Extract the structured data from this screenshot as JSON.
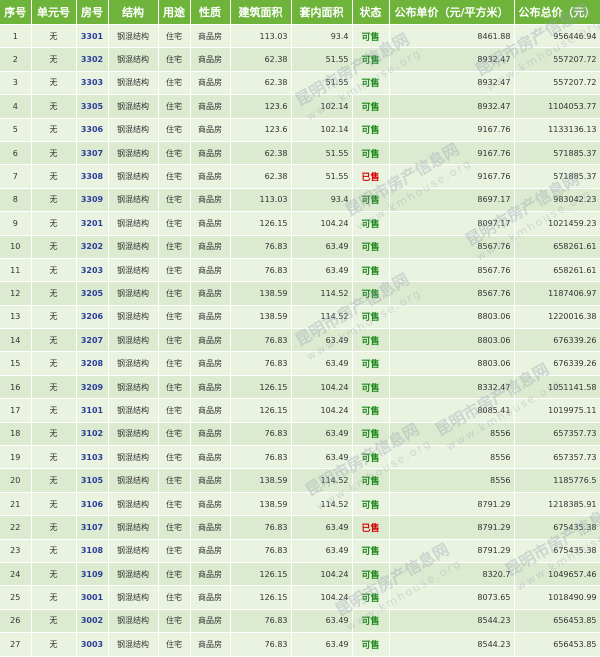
{
  "headers": [
    "序号",
    "单元号",
    "房号",
    "结构",
    "用途",
    "性质",
    "建筑面积",
    "套内面积",
    "状态",
    "公布单价（元/平方米）",
    "公布总价（元）"
  ],
  "rows": [
    [
      "1",
      "无",
      "3301",
      "钢混结构",
      "住宅",
      "商品房",
      "113.03",
      "93.4",
      "可售",
      "8461.88",
      "956446.94"
    ],
    [
      "2",
      "无",
      "3302",
      "钢混结构",
      "住宅",
      "商品房",
      "62.38",
      "51.55",
      "可售",
      "8932.47",
      "557207.72"
    ],
    [
      "3",
      "无",
      "3303",
      "钢混结构",
      "住宅",
      "商品房",
      "62.38",
      "51.55",
      "可售",
      "8932.47",
      "557207.72"
    ],
    [
      "4",
      "无",
      "3305",
      "钢混结构",
      "住宅",
      "商品房",
      "123.6",
      "102.14",
      "可售",
      "8932.47",
      "1104053.77"
    ],
    [
      "5",
      "无",
      "3306",
      "钢混结构",
      "住宅",
      "商品房",
      "123.6",
      "102.14",
      "可售",
      "9167.76",
      "1133136.13"
    ],
    [
      "6",
      "无",
      "3307",
      "钢混结构",
      "住宅",
      "商品房",
      "62.38",
      "51.55",
      "可售",
      "9167.76",
      "571885.37"
    ],
    [
      "7",
      "无",
      "3308",
      "钢混结构",
      "住宅",
      "商品房",
      "62.38",
      "51.55",
      "已售",
      "9167.76",
      "571885.37"
    ],
    [
      "8",
      "无",
      "3309",
      "钢混结构",
      "住宅",
      "商品房",
      "113.03",
      "93.4",
      "可售",
      "8697.17",
      "983042.23"
    ],
    [
      "9",
      "无",
      "3201",
      "钢混结构",
      "住宅",
      "商品房",
      "126.15",
      "104.24",
      "可售",
      "8097.17",
      "1021459.23"
    ],
    [
      "10",
      "无",
      "3202",
      "钢混结构",
      "住宅",
      "商品房",
      "76.83",
      "63.49",
      "可售",
      "8567.76",
      "658261.61"
    ],
    [
      "11",
      "无",
      "3203",
      "钢混结构",
      "住宅",
      "商品房",
      "76.83",
      "63.49",
      "可售",
      "8567.76",
      "658261.61"
    ],
    [
      "12",
      "无",
      "3205",
      "钢混结构",
      "住宅",
      "商品房",
      "138.59",
      "114.52",
      "可售",
      "8567.76",
      "1187406.97"
    ],
    [
      "13",
      "无",
      "3206",
      "钢混结构",
      "住宅",
      "商品房",
      "138.59",
      "114.52",
      "可售",
      "8803.06",
      "1220016.38"
    ],
    [
      "14",
      "无",
      "3207",
      "钢混结构",
      "住宅",
      "商品房",
      "76.83",
      "63.49",
      "可售",
      "8803.06",
      "676339.26"
    ],
    [
      "15",
      "无",
      "3208",
      "钢混结构",
      "住宅",
      "商品房",
      "76.83",
      "63.49",
      "可售",
      "8803.06",
      "676339.26"
    ],
    [
      "16",
      "无",
      "3209",
      "钢混结构",
      "住宅",
      "商品房",
      "126.15",
      "104.24",
      "可售",
      "8332.47",
      "1051141.58"
    ],
    [
      "17",
      "无",
      "3101",
      "钢混结构",
      "住宅",
      "商品房",
      "126.15",
      "104.24",
      "可售",
      "8085.41",
      "1019975.11"
    ],
    [
      "18",
      "无",
      "3102",
      "钢混结构",
      "住宅",
      "商品房",
      "76.83",
      "63.49",
      "可售",
      "8556",
      "657357.73"
    ],
    [
      "19",
      "无",
      "3103",
      "钢混结构",
      "住宅",
      "商品房",
      "76.83",
      "63.49",
      "可售",
      "8556",
      "657357.73"
    ],
    [
      "20",
      "无",
      "3105",
      "钢混结构",
      "住宅",
      "商品房",
      "138.59",
      "114.52",
      "可售",
      "8556",
      "1185776.5"
    ],
    [
      "21",
      "无",
      "3106",
      "钢混结构",
      "住宅",
      "商品房",
      "138.59",
      "114.52",
      "可售",
      "8791.29",
      "1218385.91"
    ],
    [
      "22",
      "无",
      "3107",
      "钢混结构",
      "住宅",
      "商品房",
      "76.83",
      "63.49",
      "已售",
      "8791.29",
      "675435.38"
    ],
    [
      "23",
      "无",
      "3108",
      "钢混结构",
      "住宅",
      "商品房",
      "76.83",
      "63.49",
      "可售",
      "8791.29",
      "675435.38"
    ],
    [
      "24",
      "无",
      "3109",
      "钢混结构",
      "住宅",
      "商品房",
      "126.15",
      "104.24",
      "可售",
      "8320.7",
      "1049657.46"
    ],
    [
      "25",
      "无",
      "3001",
      "钢混结构",
      "住宅",
      "商品房",
      "126.15",
      "104.24",
      "可售",
      "8073.65",
      "1018490.99"
    ],
    [
      "26",
      "无",
      "3002",
      "钢混结构",
      "住宅",
      "商品房",
      "76.83",
      "63.49",
      "可售",
      "8544.23",
      "656453.85"
    ],
    [
      "27",
      "无",
      "3003",
      "钢混结构",
      "住宅",
      "商品房",
      "76.83",
      "63.49",
      "可售",
      "8544.23",
      "656453.85"
    ]
  ],
  "status_sold_label": "已售",
  "watermark": {
    "text": "昆明市房产信息网",
    "url": "www.kmhouse.org"
  },
  "colors": {
    "header_bg": "#6fb43a",
    "available": "#1c8a1c",
    "sold": "#d40000",
    "room": "#2a3f9a"
  }
}
